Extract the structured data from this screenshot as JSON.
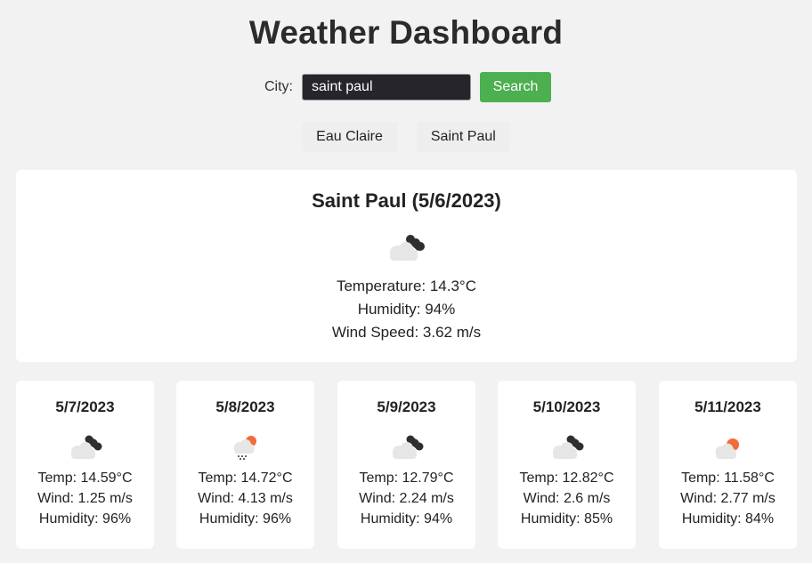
{
  "header": {
    "title": "Weather Dashboard"
  },
  "search": {
    "label": "City:",
    "value": "saint paul",
    "button_label": "Search"
  },
  "history": [
    {
      "label": "Eau Claire"
    },
    {
      "label": "Saint Paul"
    }
  ],
  "current": {
    "heading": "Saint Paul (5/6/2023)",
    "icon": "broken-clouds-icon",
    "temperature": "Temperature: 14.3°C",
    "humidity": "Humidity: 94%",
    "wind": "Wind Speed: 3.62 m/s"
  },
  "forecast": [
    {
      "date": "5/7/2023",
      "icon": "broken-clouds-icon",
      "temp": "Temp: 14.59°C",
      "wind": "Wind: 1.25 m/s",
      "humidity": "Humidity: 96%"
    },
    {
      "date": "5/8/2023",
      "icon": "rain-sun-icon",
      "temp": "Temp: 14.72°C",
      "wind": "Wind: 4.13 m/s",
      "humidity": "Humidity: 96%"
    },
    {
      "date": "5/9/2023",
      "icon": "broken-clouds-icon",
      "temp": "Temp: 12.79°C",
      "wind": "Wind: 2.24 m/s",
      "humidity": "Humidity: 94%"
    },
    {
      "date": "5/10/2023",
      "icon": "broken-clouds-icon",
      "temp": "Temp: 12.82°C",
      "wind": "Wind: 2.6 m/s",
      "humidity": "Humidity: 85%"
    },
    {
      "date": "5/11/2023",
      "icon": "partly-cloudy-icon",
      "temp": "Temp: 11.58°C",
      "wind": "Wind: 2.77 m/s",
      "humidity": "Humidity: 84%"
    }
  ],
  "colors": {
    "background": "#f2f2f2",
    "card": "#ffffff",
    "accent": "#4caf50",
    "input_bg": "#25252b",
    "sun": "#f26b3a"
  }
}
